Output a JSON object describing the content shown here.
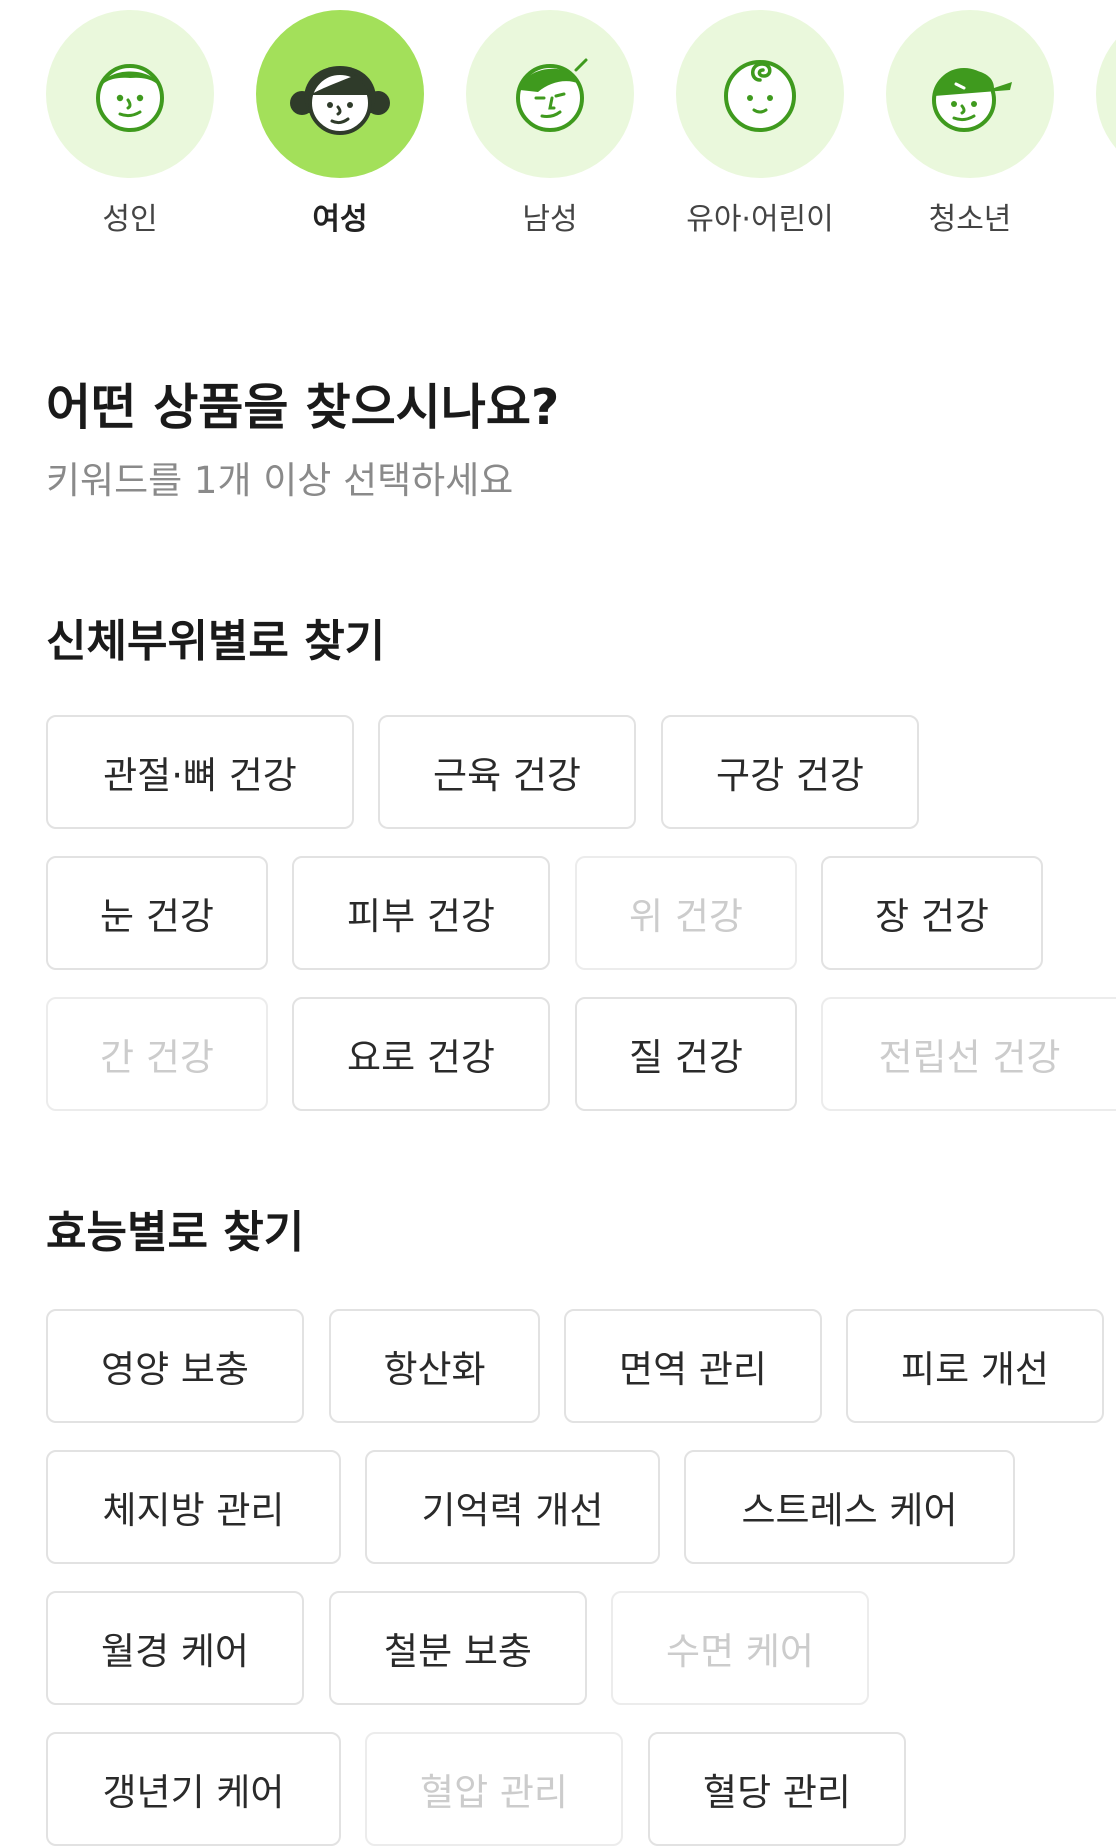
{
  "audience": {
    "items": [
      {
        "name": "adult",
        "label": "성인",
        "icon": "adult-face-icon",
        "selected": false
      },
      {
        "name": "women",
        "label": "여성",
        "icon": "woman-face-icon",
        "selected": true
      },
      {
        "name": "men",
        "label": "남성",
        "icon": "man-face-icon",
        "selected": false
      },
      {
        "name": "kids",
        "label": "유아·어린이",
        "icon": "baby-face-icon",
        "selected": false
      },
      {
        "name": "teens",
        "label": "청소년",
        "icon": "teen-face-icon",
        "selected": false
      }
    ]
  },
  "header": {
    "title": "어떤 상품을 찾으시나요?",
    "subtitle": "키워드를 1개 이상 선택하세요"
  },
  "body_parts": {
    "title": "신체부위별로 찾기",
    "chips": [
      {
        "label": "관절·뼈 건강",
        "enabled": true
      },
      {
        "label": "근육 건강",
        "enabled": true
      },
      {
        "label": "구강 건강",
        "enabled": true
      },
      {
        "label": "눈 건강",
        "enabled": true
      },
      {
        "label": "피부 건강",
        "enabled": true
      },
      {
        "label": "위 건강",
        "enabled": false
      },
      {
        "label": "장 건강",
        "enabled": true
      },
      {
        "label": "간 건강",
        "enabled": false
      },
      {
        "label": "요로 건강",
        "enabled": true
      },
      {
        "label": "질 건강",
        "enabled": true
      },
      {
        "label": "전립선 건강",
        "enabled": false
      }
    ]
  },
  "effects": {
    "title": "효능별로 찾기",
    "chips": [
      {
        "label": "영양 보충",
        "enabled": true
      },
      {
        "label": "항산화",
        "enabled": true
      },
      {
        "label": "면역 관리",
        "enabled": true
      },
      {
        "label": "피로 개선",
        "enabled": true
      },
      {
        "label": "체지방 관리",
        "enabled": true
      },
      {
        "label": "기억력 개선",
        "enabled": true
      },
      {
        "label": "스트레스 케어",
        "enabled": true
      },
      {
        "label": "월경 케어",
        "enabled": true
      },
      {
        "label": "철분 보충",
        "enabled": true
      },
      {
        "label": "수면 케어",
        "enabled": false
      },
      {
        "label": "갱년기 케어",
        "enabled": true
      },
      {
        "label": "혈압 관리",
        "enabled": false
      },
      {
        "label": "혈당 관리",
        "enabled": true
      }
    ]
  },
  "colors": {
    "accent": "#a3e05a",
    "accent_light": "#eaf8dc",
    "icon_stroke": "#3f9a1e",
    "chip_border": "#e2e2e2",
    "text_disabled": "#cccccc"
  }
}
